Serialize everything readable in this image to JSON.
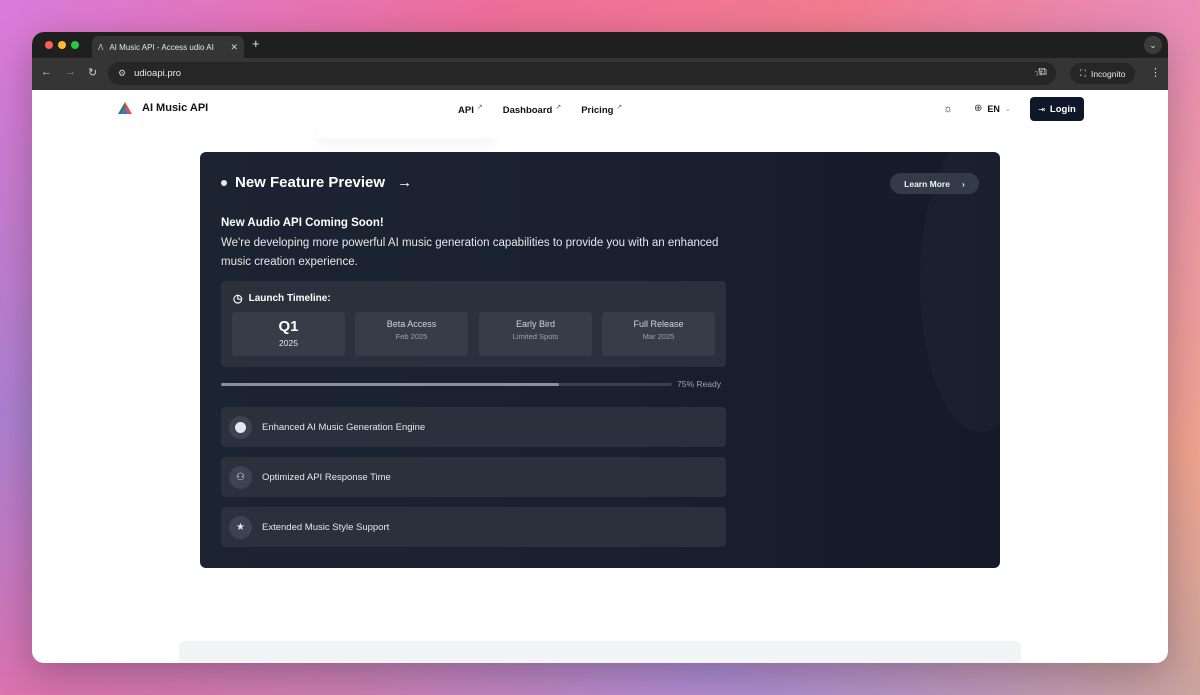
{
  "browser": {
    "tab_title": "AI Music API - Access udio AI",
    "tab_favicon": "Λ",
    "new_tab": "+",
    "url": "udioapi.pro",
    "incognito_label": "Incognito"
  },
  "site": {
    "brand_name": "AI Music API",
    "nav": [
      {
        "label": "API"
      },
      {
        "label": "Dashboard"
      },
      {
        "label": "Pricing"
      }
    ],
    "nav_external_marker": "↗",
    "language": "EN",
    "login_label": "Login"
  },
  "preview": {
    "title": "New Feature Preview",
    "learn_more": "Learn More",
    "subtitle": "New Audio API Coming Soon!",
    "description": "We're developing more powerful AI music generation capabilities to provide you with an enhanced music creation experience.",
    "timeline_heading": "Launch Timeline:",
    "timeline": [
      {
        "name": "Q1",
        "sub": "2025"
      },
      {
        "name": "Beta Access",
        "sub": "Feb 2025"
      },
      {
        "name": "Early Bird",
        "sub": "Limited Spots"
      },
      {
        "name": "Full Release",
        "sub": "Mar 2025"
      }
    ],
    "progress_fraction": 0.75,
    "progress_label": "75% Ready",
    "features": [
      {
        "label": "Enhanced AI Music Generation Engine",
        "icon": "circle-icon"
      },
      {
        "label": "Optimized API Response Time",
        "icon": "users-icon"
      },
      {
        "label": "Extended Music Style Support",
        "icon": "star-icon"
      }
    ]
  },
  "colors": {
    "card_bg": "#1a2030",
    "login_bg": "#0f172a",
    "progress_fill": "#8b919c"
  }
}
